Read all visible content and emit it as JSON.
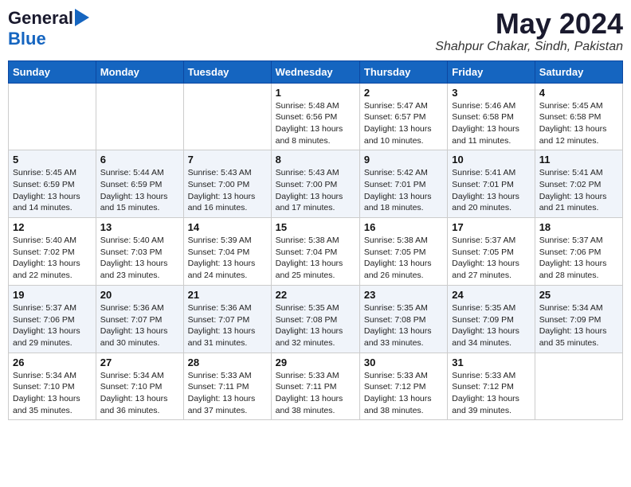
{
  "header": {
    "logo_general": "General",
    "logo_blue": "Blue",
    "month_title": "May 2024",
    "location": "Shahpur Chakar, Sindh, Pakistan"
  },
  "weekdays": [
    "Sunday",
    "Monday",
    "Tuesday",
    "Wednesday",
    "Thursday",
    "Friday",
    "Saturday"
  ],
  "weeks": [
    [
      {
        "day": "",
        "info": ""
      },
      {
        "day": "",
        "info": ""
      },
      {
        "day": "",
        "info": ""
      },
      {
        "day": "1",
        "info": "Sunrise: 5:48 AM\nSunset: 6:56 PM\nDaylight: 13 hours\nand 8 minutes."
      },
      {
        "day": "2",
        "info": "Sunrise: 5:47 AM\nSunset: 6:57 PM\nDaylight: 13 hours\nand 10 minutes."
      },
      {
        "day": "3",
        "info": "Sunrise: 5:46 AM\nSunset: 6:58 PM\nDaylight: 13 hours\nand 11 minutes."
      },
      {
        "day": "4",
        "info": "Sunrise: 5:45 AM\nSunset: 6:58 PM\nDaylight: 13 hours\nand 12 minutes."
      }
    ],
    [
      {
        "day": "5",
        "info": "Sunrise: 5:45 AM\nSunset: 6:59 PM\nDaylight: 13 hours\nand 14 minutes."
      },
      {
        "day": "6",
        "info": "Sunrise: 5:44 AM\nSunset: 6:59 PM\nDaylight: 13 hours\nand 15 minutes."
      },
      {
        "day": "7",
        "info": "Sunrise: 5:43 AM\nSunset: 7:00 PM\nDaylight: 13 hours\nand 16 minutes."
      },
      {
        "day": "8",
        "info": "Sunrise: 5:43 AM\nSunset: 7:00 PM\nDaylight: 13 hours\nand 17 minutes."
      },
      {
        "day": "9",
        "info": "Sunrise: 5:42 AM\nSunset: 7:01 PM\nDaylight: 13 hours\nand 18 minutes."
      },
      {
        "day": "10",
        "info": "Sunrise: 5:41 AM\nSunset: 7:01 PM\nDaylight: 13 hours\nand 20 minutes."
      },
      {
        "day": "11",
        "info": "Sunrise: 5:41 AM\nSunset: 7:02 PM\nDaylight: 13 hours\nand 21 minutes."
      }
    ],
    [
      {
        "day": "12",
        "info": "Sunrise: 5:40 AM\nSunset: 7:02 PM\nDaylight: 13 hours\nand 22 minutes."
      },
      {
        "day": "13",
        "info": "Sunrise: 5:40 AM\nSunset: 7:03 PM\nDaylight: 13 hours\nand 23 minutes."
      },
      {
        "day": "14",
        "info": "Sunrise: 5:39 AM\nSunset: 7:04 PM\nDaylight: 13 hours\nand 24 minutes."
      },
      {
        "day": "15",
        "info": "Sunrise: 5:38 AM\nSunset: 7:04 PM\nDaylight: 13 hours\nand 25 minutes."
      },
      {
        "day": "16",
        "info": "Sunrise: 5:38 AM\nSunset: 7:05 PM\nDaylight: 13 hours\nand 26 minutes."
      },
      {
        "day": "17",
        "info": "Sunrise: 5:37 AM\nSunset: 7:05 PM\nDaylight: 13 hours\nand 27 minutes."
      },
      {
        "day": "18",
        "info": "Sunrise: 5:37 AM\nSunset: 7:06 PM\nDaylight: 13 hours\nand 28 minutes."
      }
    ],
    [
      {
        "day": "19",
        "info": "Sunrise: 5:37 AM\nSunset: 7:06 PM\nDaylight: 13 hours\nand 29 minutes."
      },
      {
        "day": "20",
        "info": "Sunrise: 5:36 AM\nSunset: 7:07 PM\nDaylight: 13 hours\nand 30 minutes."
      },
      {
        "day": "21",
        "info": "Sunrise: 5:36 AM\nSunset: 7:07 PM\nDaylight: 13 hours\nand 31 minutes."
      },
      {
        "day": "22",
        "info": "Sunrise: 5:35 AM\nSunset: 7:08 PM\nDaylight: 13 hours\nand 32 minutes."
      },
      {
        "day": "23",
        "info": "Sunrise: 5:35 AM\nSunset: 7:08 PM\nDaylight: 13 hours\nand 33 minutes."
      },
      {
        "day": "24",
        "info": "Sunrise: 5:35 AM\nSunset: 7:09 PM\nDaylight: 13 hours\nand 34 minutes."
      },
      {
        "day": "25",
        "info": "Sunrise: 5:34 AM\nSunset: 7:09 PM\nDaylight: 13 hours\nand 35 minutes."
      }
    ],
    [
      {
        "day": "26",
        "info": "Sunrise: 5:34 AM\nSunset: 7:10 PM\nDaylight: 13 hours\nand 35 minutes."
      },
      {
        "day": "27",
        "info": "Sunrise: 5:34 AM\nSunset: 7:10 PM\nDaylight: 13 hours\nand 36 minutes."
      },
      {
        "day": "28",
        "info": "Sunrise: 5:33 AM\nSunset: 7:11 PM\nDaylight: 13 hours\nand 37 minutes."
      },
      {
        "day": "29",
        "info": "Sunrise: 5:33 AM\nSunset: 7:11 PM\nDaylight: 13 hours\nand 38 minutes."
      },
      {
        "day": "30",
        "info": "Sunrise: 5:33 AM\nSunset: 7:12 PM\nDaylight: 13 hours\nand 38 minutes."
      },
      {
        "day": "31",
        "info": "Sunrise: 5:33 AM\nSunset: 7:12 PM\nDaylight: 13 hours\nand 39 minutes."
      },
      {
        "day": "",
        "info": ""
      }
    ]
  ]
}
